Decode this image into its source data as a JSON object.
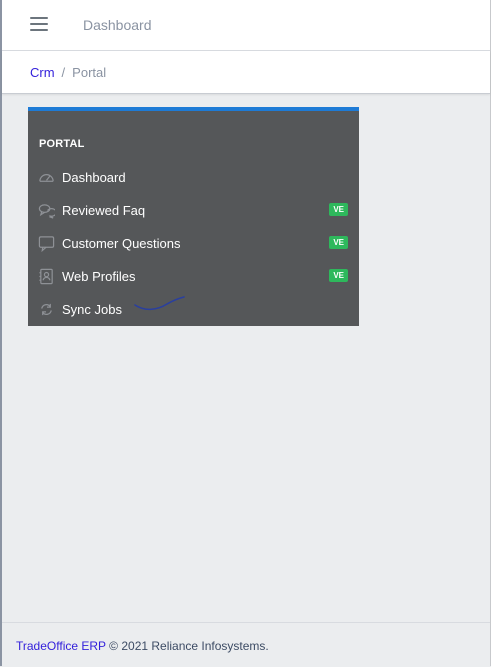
{
  "header": {
    "menu_icon": "hamburger-icon",
    "nav_link": "Dashboard"
  },
  "breadcrumb": {
    "items": [
      "Crm",
      "Portal"
    ],
    "separator": "/"
  },
  "portal_menu": {
    "title": "PORTAL",
    "accent_color": "#1e7bd6",
    "items": [
      {
        "label": "Dashboard",
        "icon": "speedometer-icon",
        "badge": ""
      },
      {
        "label": "Reviewed Faq",
        "icon": "chat-bubbles-icon",
        "badge": "VE"
      },
      {
        "label": "Customer Questions",
        "icon": "comment-square-icon",
        "badge": "VE"
      },
      {
        "label": "Web Profiles",
        "icon": "contact-icon",
        "badge": "VE"
      },
      {
        "label": "Sync Jobs",
        "icon": "sync-icon",
        "badge": ""
      }
    ]
  },
  "footer": {
    "brand": "TradeOffice ERP",
    "text": "© 2021 Reliance Infosystems."
  }
}
